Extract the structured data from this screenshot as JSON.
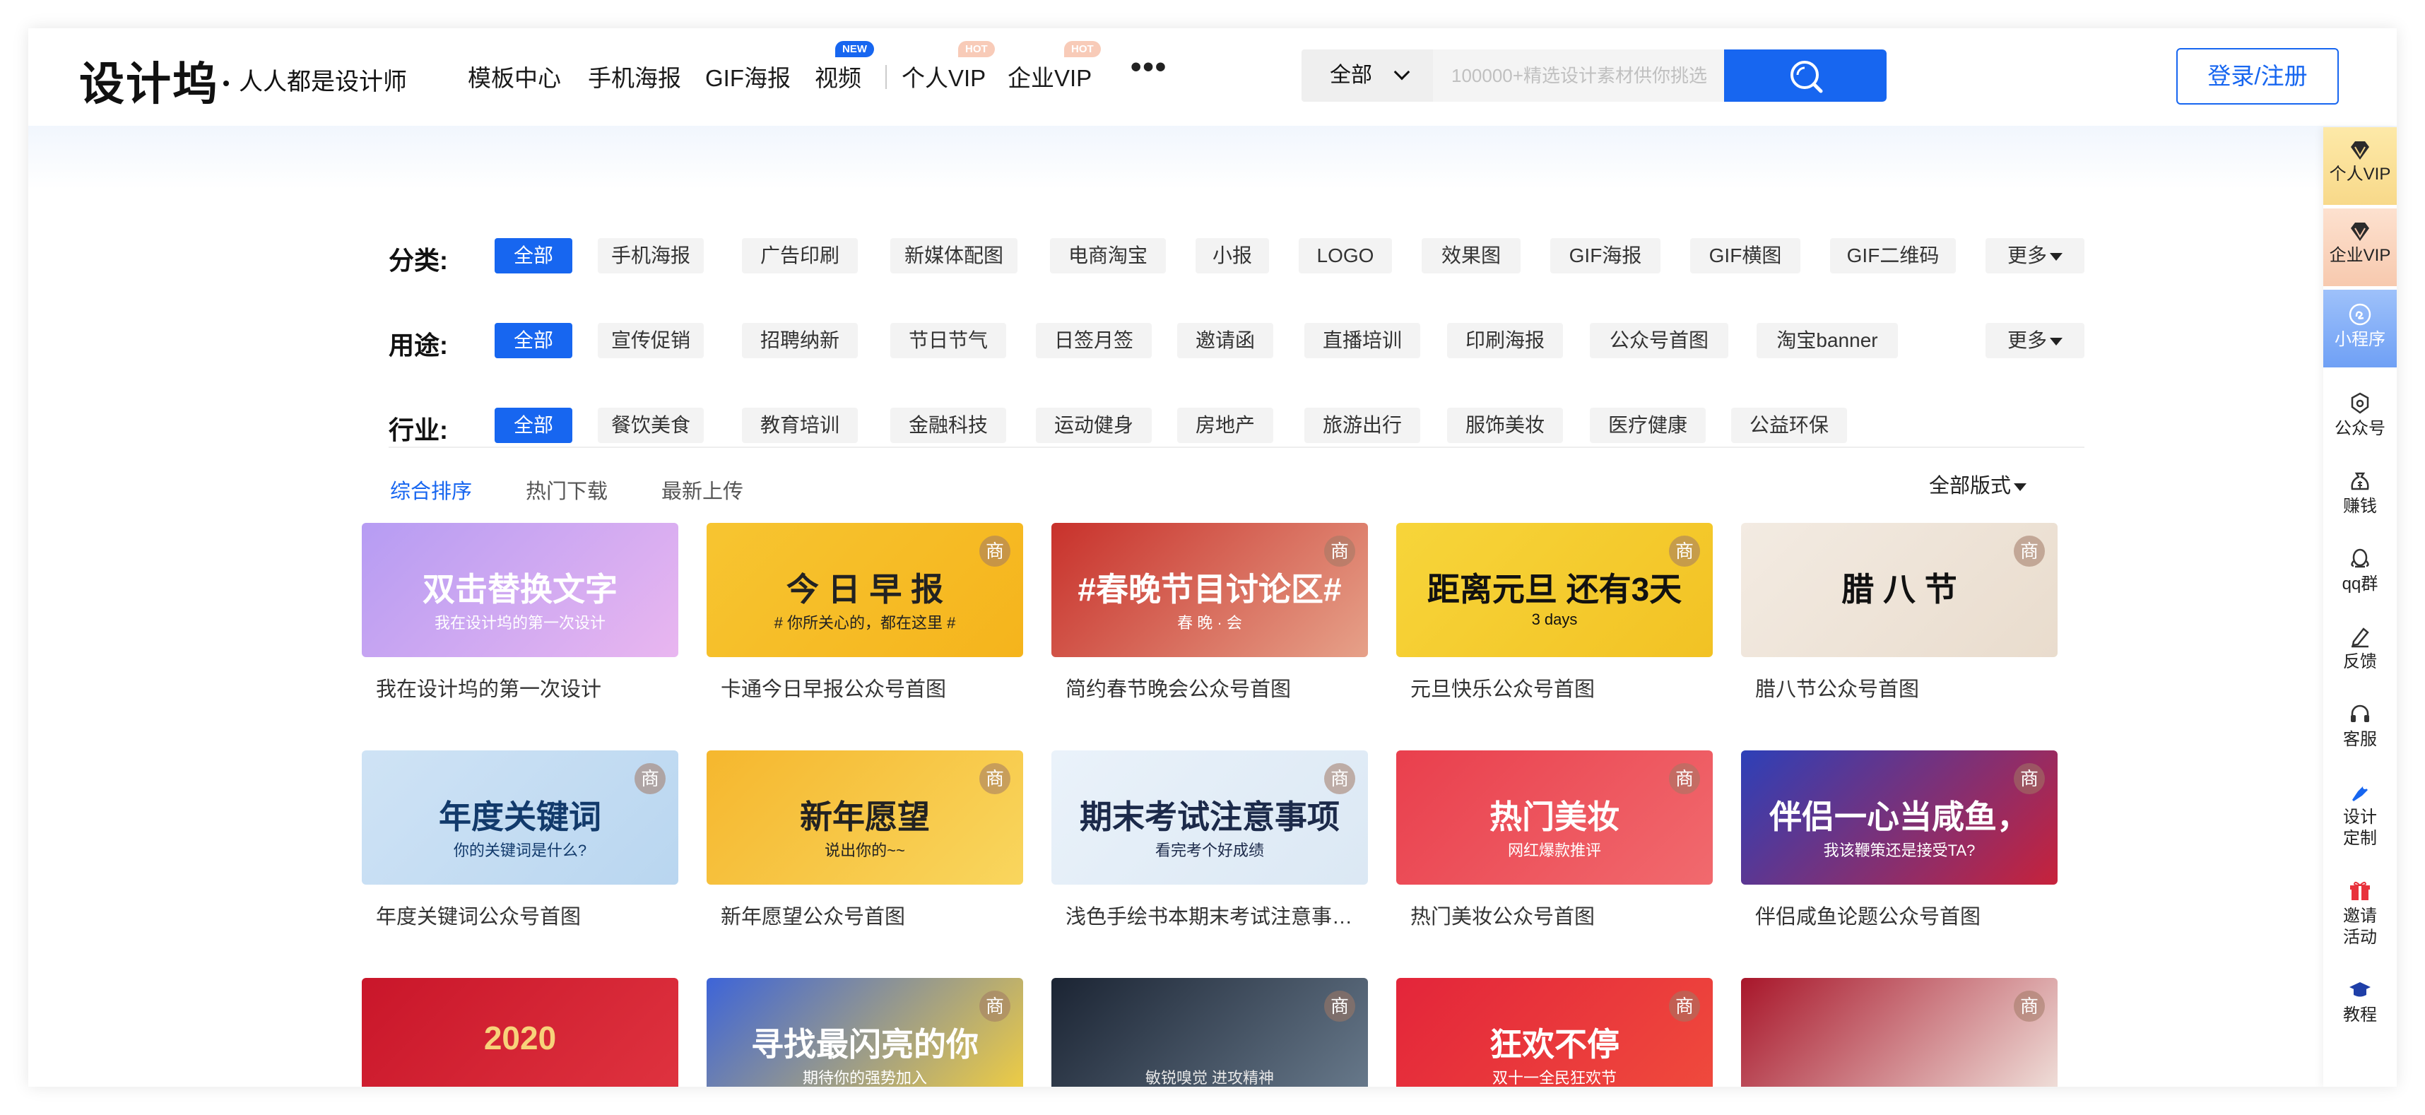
{
  "header": {
    "logo": "设计坞",
    "slogan": "人人都是设计师",
    "nav": [
      {
        "label": "模板中心"
      },
      {
        "label": "手机海报"
      },
      {
        "label": "GIF海报"
      },
      {
        "label": "视频",
        "badge": "NEW"
      },
      {
        "label": "个人VIP",
        "badge": "HOT"
      },
      {
        "label": "企业VIP",
        "badge": "HOT"
      }
    ],
    "more_icon": "more-dots-icon",
    "search": {
      "scope": "全部",
      "placeholder": "100000+精选设计素材供你挑选",
      "icon": "search-icon"
    },
    "login_label": "登录/注册"
  },
  "sidebar": [
    {
      "label": "个人VIP",
      "icon": "diamond-icon"
    },
    {
      "label": "企业VIP",
      "icon": "diamond-icon"
    },
    {
      "label": "小程序",
      "icon": "mini-program-icon"
    },
    {
      "label": "公众号",
      "icon": "official-account-icon"
    },
    {
      "label": "赚钱",
      "icon": "money-bag-icon"
    },
    {
      "label": "qq群",
      "icon": "qq-icon"
    },
    {
      "label": "反馈",
      "icon": "pencil-icon"
    },
    {
      "label": "客服",
      "icon": "headset-icon"
    },
    {
      "label": "设计定制",
      "label_line1": "设计",
      "label_line2": "定制",
      "icon": "pen-tool-icon"
    },
    {
      "label": "邀请活动",
      "label_line1": "邀请",
      "label_line2": "活动",
      "icon": "gift-icon"
    },
    {
      "label": "教程",
      "icon": "graduation-cap-icon"
    }
  ],
  "filters": {
    "category": {
      "label": "分类:",
      "chips": [
        "全部",
        "手机海报",
        "广告印刷",
        "新媒体配图",
        "电商淘宝",
        "小报",
        "LOGO",
        "效果图",
        "GIF海报",
        "GIF横图",
        "GIF二维码"
      ],
      "more": "更多"
    },
    "usage": {
      "label": "用途:",
      "chips": [
        "全部",
        "宣传促销",
        "招聘纳新",
        "节日节气",
        "日签月签",
        "邀请函",
        "直播培训",
        "印刷海报",
        "公众号首图",
        "淘宝banner"
      ],
      "more": "更多"
    },
    "industry": {
      "label": "行业:",
      "chips": [
        "全部",
        "餐饮美食",
        "教育培训",
        "金融科技",
        "运动健身",
        "房地产",
        "旅游出行",
        "服饰美妆",
        "医疗健康",
        "公益环保"
      ]
    }
  },
  "sort": {
    "tabs": [
      "综合排序",
      "热门下载",
      "最新上传"
    ],
    "active": "综合排序",
    "format": "全部版式"
  },
  "cards": [
    {
      "title": "我在设计坞的第一次设计",
      "thumb_text": "双击替换文字",
      "thumb_sub": "我在设计坞的第一次设计",
      "colors": [
        "#b69cf3",
        "#e9b6f0"
      ],
      "fg": "#ffffff",
      "commercial": false
    },
    {
      "title": "卡通今日早报公众号首图",
      "thumb_text": "今 日 早 报",
      "thumb_sub": "# 你所关心的，都在这里 #",
      "colors": [
        "#f7c531",
        "#f5b41c"
      ],
      "fg": "#222222",
      "commercial": true
    },
    {
      "title": "简约春节晚会公众号首图",
      "thumb_text": "#春晚节目讨论区#",
      "thumb_sub": "春 晚 · 会",
      "colors": [
        "#c8312b",
        "#e6a189"
      ],
      "fg": "#ffffff",
      "commercial": true
    },
    {
      "title": "元旦快乐公众号首图",
      "thumb_text": "距离元旦 还有3天",
      "thumb_sub": "3 days",
      "colors": [
        "#f7d53a",
        "#f2c224"
      ],
      "fg": "#111111",
      "commercial": true
    },
    {
      "title": "腊八节公众号首图",
      "thumb_text": "腊 八 节",
      "thumb_sub": "",
      "colors": [
        "#f3ebe2",
        "#e9dccd"
      ],
      "fg": "#111111",
      "commercial": true
    },
    {
      "title": "年度关键词公众号首图",
      "thumb_text": "年度关键词",
      "thumb_sub": "你的关键词是什么?",
      "colors": [
        "#cfe3f5",
        "#b9d6f0"
      ],
      "fg": "#123a6b",
      "commercial": true
    },
    {
      "title": "新年愿望公众号首图",
      "thumb_text": "新年愿望",
      "thumb_sub": "说出你的~~",
      "colors": [
        "#f5b72e",
        "#f9d65e"
      ],
      "fg": "#222222",
      "commercial": true
    },
    {
      "title": "浅色手绘书本期末考试注意事项公众号首图",
      "thumb_text": "期末考试注意事项",
      "thumb_sub": "看完考个好成绩",
      "colors": [
        "#eaf2fa",
        "#dbe8f4"
      ],
      "fg": "#1c2a4a",
      "commercial": true
    },
    {
      "title": "热门美妆公众号首图",
      "thumb_text": "热门美妆",
      "thumb_sub": "网红爆款推评",
      "colors": [
        "#e93f4d",
        "#f16a6e"
      ],
      "fg": "#ffffff",
      "commercial": true
    },
    {
      "title": "伴侣咸鱼论题公众号首图",
      "thumb_text": "伴侣一心当咸鱼，",
      "thumb_sub": "我该鞭策还是接受TA?",
      "colors": [
        "#2d40b8",
        "#c7223b"
      ],
      "fg": "#ffffff",
      "commercial": true
    },
    {
      "title": "",
      "thumb_text": "2020",
      "thumb_sub": "",
      "colors": [
        "#c9162a",
        "#e03440"
      ],
      "fg": "#f7d27a",
      "commercial": false
    },
    {
      "title": "",
      "thumb_text": "寻找最闪亮的你",
      "thumb_sub": "期待你的强势加入",
      "colors": [
        "#3d64d8",
        "#f7d23c"
      ],
      "fg": "#ffffff",
      "commercial": true
    },
    {
      "title": "",
      "thumb_text": "",
      "thumb_sub": "敏锐嗅觉 进攻精神",
      "colors": [
        "#1b2433",
        "#6b7d8f"
      ],
      "fg": "#e6e6e6",
      "commercial": true
    },
    {
      "title": "",
      "thumb_text": "狂欢不停",
      "thumb_sub": "双十一全民狂欢节",
      "colors": [
        "#e3253a",
        "#f04c3d"
      ],
      "fg": "#ffffff",
      "commercial": true
    },
    {
      "title": "",
      "thumb_text": "",
      "thumb_sub": "",
      "colors": [
        "#a8162a",
        "#f3e9e2"
      ],
      "fg": "#a8162a",
      "commercial": true
    }
  ]
}
